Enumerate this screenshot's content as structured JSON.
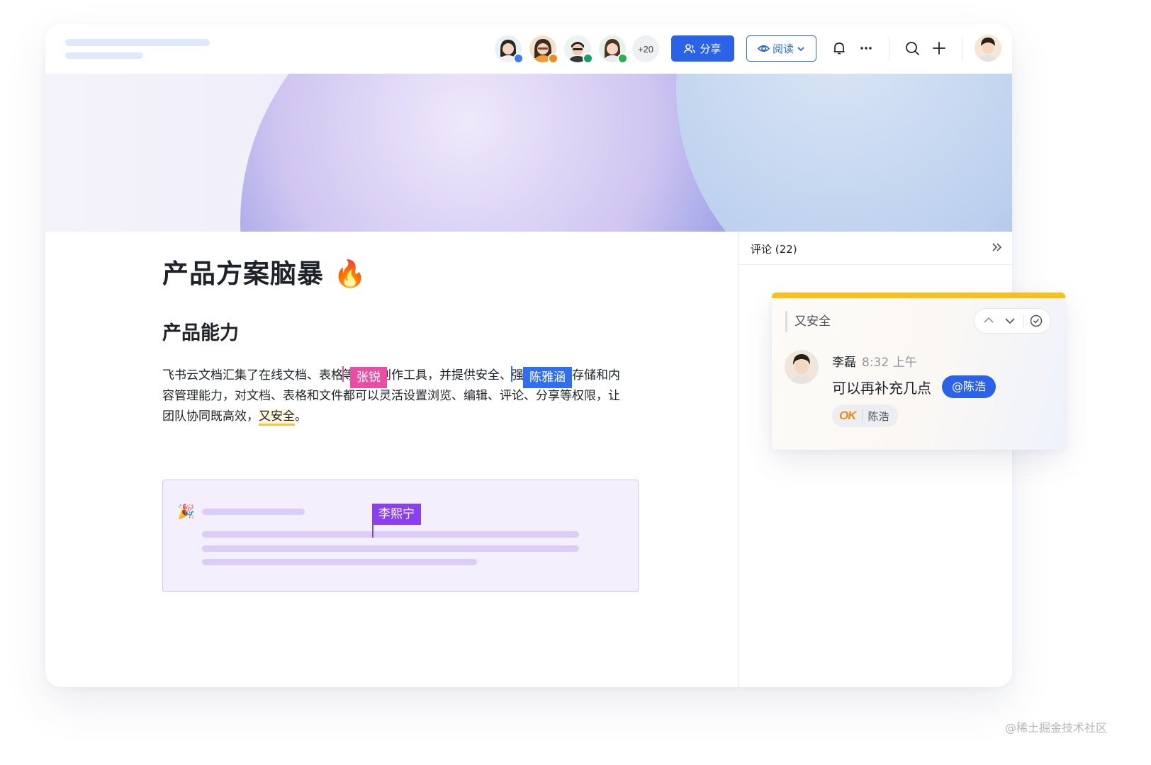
{
  "toolbar": {
    "extra_collaborators": "+20",
    "share_label": "分享",
    "read_label": "阅读"
  },
  "colors": {
    "primary": "#2a62e8",
    "flag_zhangrui": "#e94ea5",
    "flag_chenyahan": "#2f6ff0",
    "flag_lixining": "#8a3ff0",
    "comment_accent": "#f7c11a",
    "highlight": "#f7c544"
  },
  "document": {
    "title": "产品方案脑暴",
    "title_emoji": "🔥",
    "heading": "产品能力",
    "paragraph": {
      "l1_a": "飞书云文档汇集了在线文档、表格",
      "l1_b": "等在线创作工具，并提供安全、",
      "l1_c": "强大的云端存储和内",
      "l2": "容管理能力，对文档、表格和文件都可以灵活设置浏览、编辑、评论、分享等权限，让",
      "l3_a": "团队协同既高效，",
      "l3_highlight": "又安全",
      "l3_end": "。"
    },
    "cursor_flags": {
      "zhangrui": "张锐",
      "chenyahan": "陈雅涵",
      "lixining": "李熙宁"
    },
    "callout_emoji": "🎉"
  },
  "comments": {
    "panel_title": "评论 (22)",
    "card": {
      "quote": "又安全",
      "author": "李磊",
      "time": "8:32 上午",
      "text": "可以再补充几点",
      "mention": "@陈浩",
      "reaction_emoji": "OK",
      "reaction_user": "陈浩"
    }
  },
  "watermark": "@稀土掘金技术社区"
}
